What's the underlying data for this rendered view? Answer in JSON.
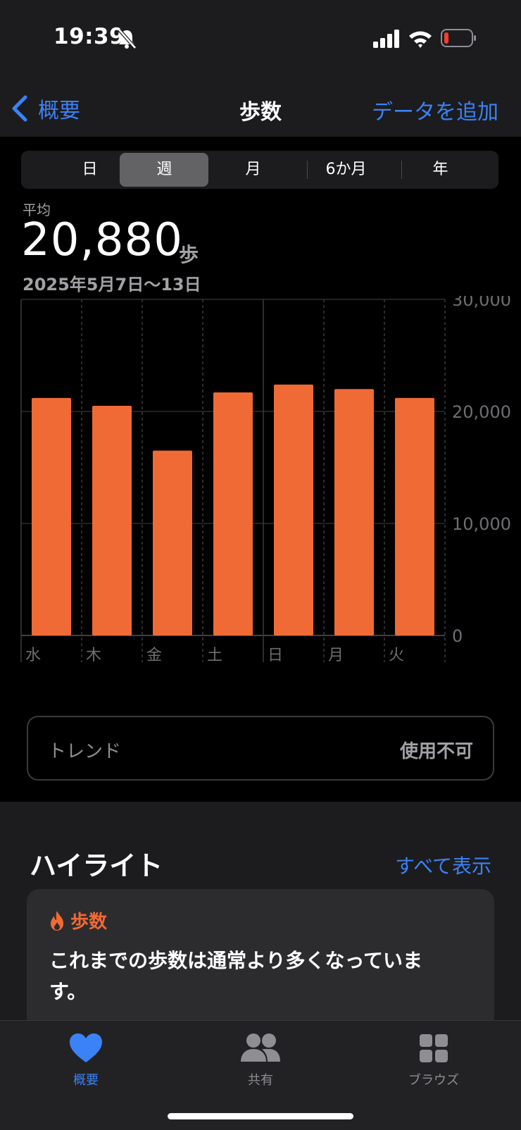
{
  "status": {
    "time": "19:39"
  },
  "nav": {
    "back": "概要",
    "title": "歩数",
    "add": "データを追加"
  },
  "segments": [
    "日",
    "週",
    "月",
    "6か月",
    "年"
  ],
  "selected_segment": "週",
  "summary": {
    "label": "平均",
    "value": "20,880",
    "unit": "歩",
    "range": "2025年5月7日〜13日"
  },
  "chart_data": {
    "type": "bar",
    "categories": [
      "水",
      "木",
      "金",
      "土",
      "日",
      "月",
      "火"
    ],
    "values": [
      21200,
      20500,
      16500,
      21700,
      22400,
      22000,
      21200
    ],
    "ylim": [
      0,
      30000
    ],
    "yticks": [
      "0",
      "10,000",
      "20,000",
      "30,000"
    ],
    "bar_color": "#f06a35",
    "grid": true
  },
  "trend": {
    "label": "トレンド",
    "value": "使用不可"
  },
  "highlights": {
    "heading": "ハイライト",
    "show_all": "すべて表示",
    "card": {
      "tag": "歩数",
      "text": "これまでの歩数は通常より多くなっています。"
    }
  },
  "tabs": [
    {
      "label": "概要",
      "icon": "heart-icon"
    },
    {
      "label": "共有",
      "icon": "people-icon"
    },
    {
      "label": "ブラウズ",
      "icon": "grid-icon"
    }
  ],
  "colors": {
    "accent": "#3b82f6",
    "bar": "#f06a35"
  }
}
